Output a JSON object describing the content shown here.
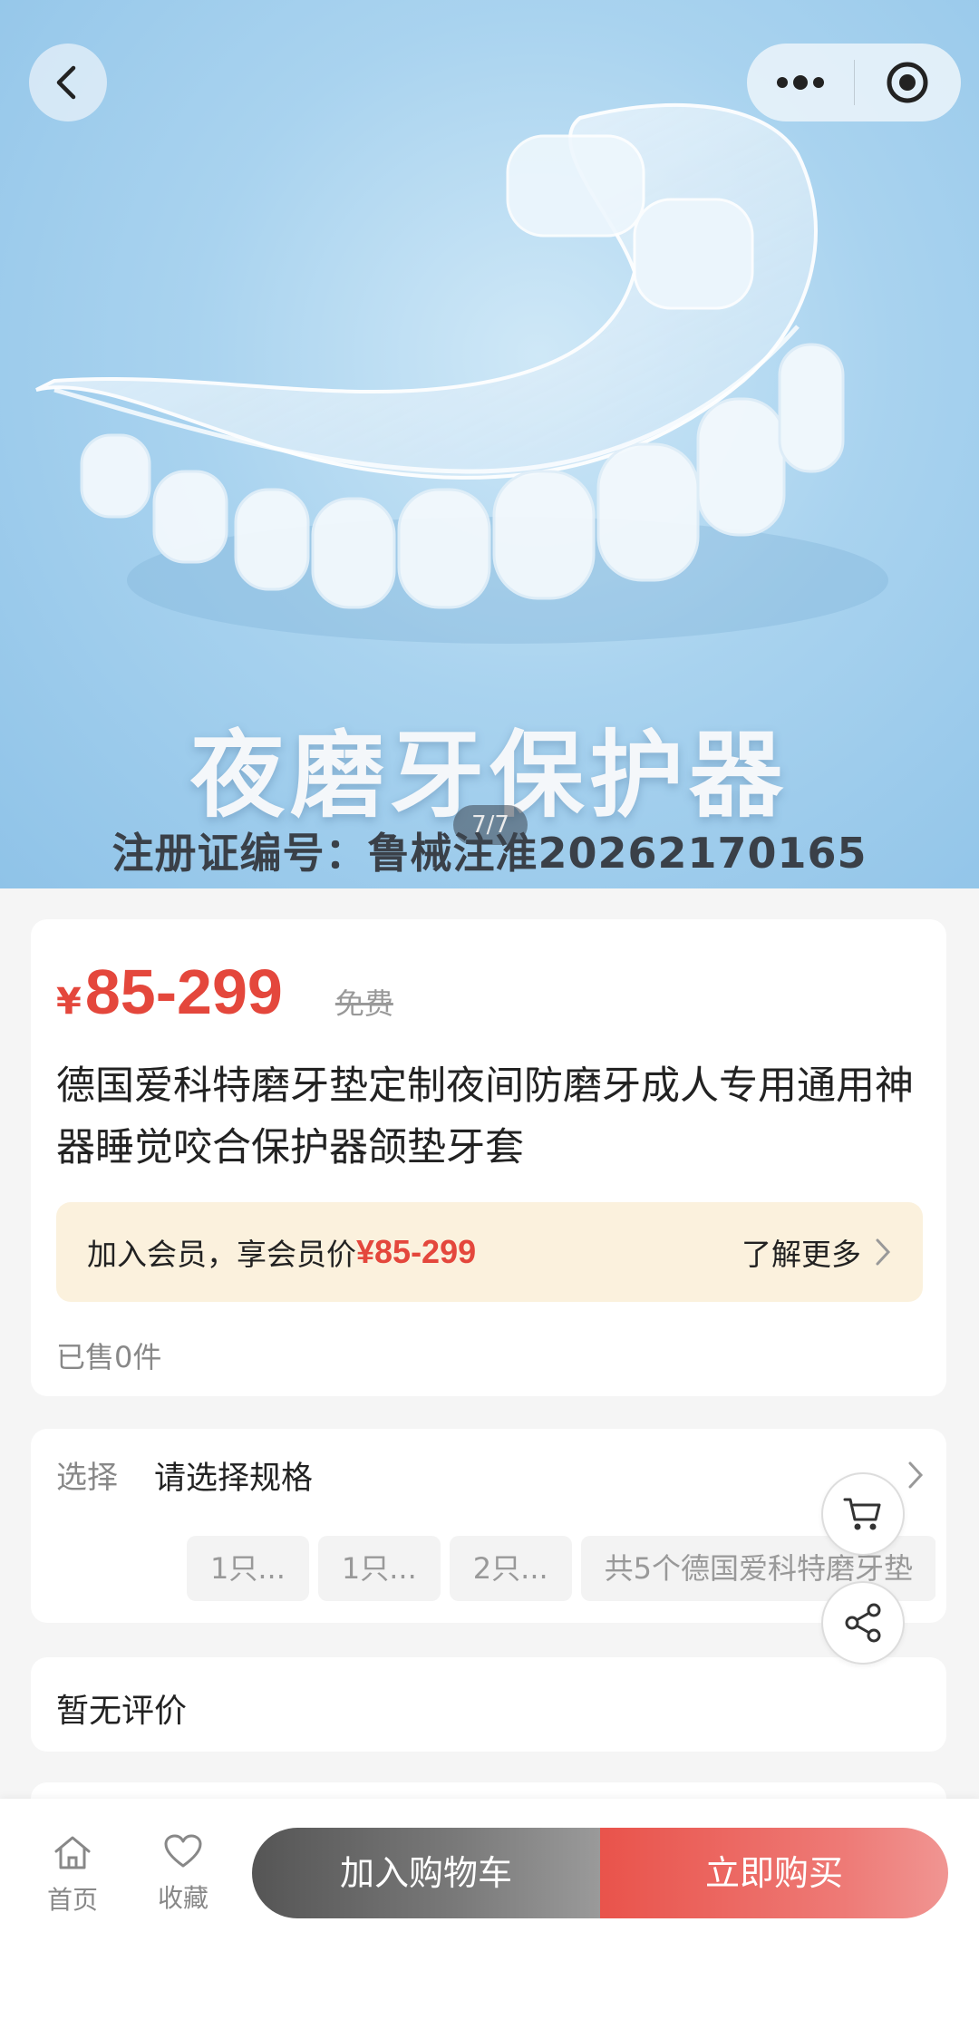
{
  "hero": {
    "image_title": "夜磨牙保护器",
    "registration": "注册证编号：鲁械注准20262170165",
    "counter": "7/7"
  },
  "nav": {
    "back_icon": "chevron-left-icon",
    "more_icon": "more-dots-icon",
    "close_icon": "target-circle-icon"
  },
  "product": {
    "currency": "¥",
    "price": "85-299",
    "original_price": "免费",
    "title": "德国爱科特磨牙垫定制夜间防磨牙成人专用通用神器睡觉咬合保护器颌垫牙套",
    "member_text": "加入会员，享会员价",
    "member_price": "¥85-299",
    "member_more": "了解更多",
    "sold": "已售0件"
  },
  "spec": {
    "label": "选择",
    "value": "请选择规格",
    "chips": [
      "1只...",
      "1只...",
      "2只...",
      "共5个德国爱科特磨牙垫"
    ]
  },
  "review": {
    "text": "暂无评价"
  },
  "bottom": {
    "home_label": "首页",
    "fav_label": "收藏",
    "add_cart": "加入购物车",
    "buy_now": "立即购买"
  },
  "colors": {
    "accent_red": "#e4473c",
    "member_bg": "#fbf1dd",
    "hero_blue": "#a9d3ef"
  }
}
